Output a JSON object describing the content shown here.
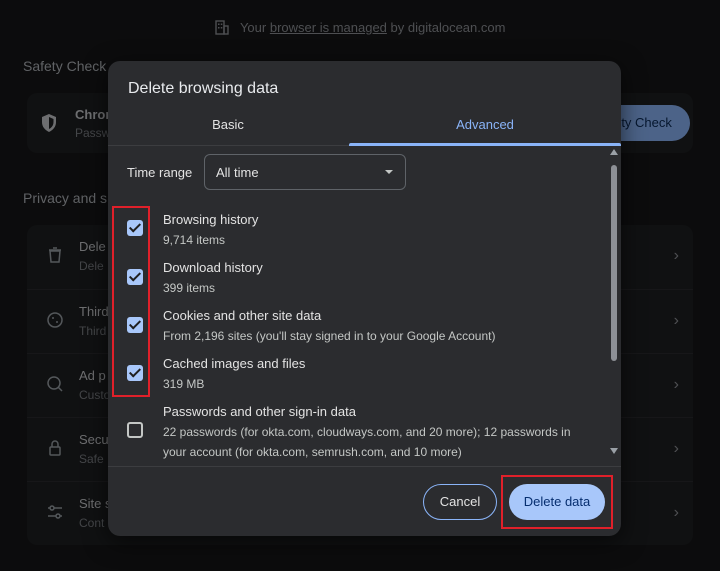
{
  "banner": {
    "prefix": "Your",
    "link": "browser is managed",
    "suffix": "by digitalocean.com"
  },
  "background": {
    "safety_check_title": "Safety Check",
    "safety_row": {
      "title": "Chron",
      "subtitle": "Passw",
      "button": "ety Check"
    },
    "privacy_title": "Privacy and s",
    "rows": [
      {
        "title": "Dele",
        "subtitle": "Dele",
        "icon": "trash-icon"
      },
      {
        "title": "Third",
        "subtitle": "Third",
        "icon": "cookie-icon"
      },
      {
        "title": "Ad p",
        "subtitle": "Custo",
        "icon": "ad-privacy-icon"
      },
      {
        "title": "Secu",
        "subtitle": "Safe",
        "icon": "lock-icon"
      },
      {
        "title": "Site s",
        "subtitle": "Cont",
        "icon": "sliders-icon"
      }
    ]
  },
  "dialog": {
    "title": "Delete browsing data",
    "tabs": {
      "basic": "Basic",
      "advanced": "Advanced"
    },
    "time_range": {
      "label": "Time range",
      "value": "All time"
    },
    "items": [
      {
        "title": "Browsing history",
        "subtitle": "9,714 items",
        "checked": true
      },
      {
        "title": "Download history",
        "subtitle": "399 items",
        "checked": true
      },
      {
        "title": "Cookies and other site data",
        "subtitle": "From 2,196 sites (you'll stay signed in to your Google Account)",
        "checked": true
      },
      {
        "title": "Cached images and files",
        "subtitle": "319 MB",
        "checked": true
      },
      {
        "title": "Passwords and other sign-in data",
        "subtitle": "22 passwords (for okta.com, cloudways.com, and 20 more); 12 passwords in your account (for okta.com, semrush.com, and 10 more)",
        "checked": false
      }
    ],
    "cancel_label": "Cancel",
    "delete_label": "Delete data"
  },
  "colors": {
    "accent": "#8ab4f8",
    "checkbox": "#a8c7fa",
    "highlight": "#e0202a",
    "dialog_bg": "#2b2c2f"
  }
}
